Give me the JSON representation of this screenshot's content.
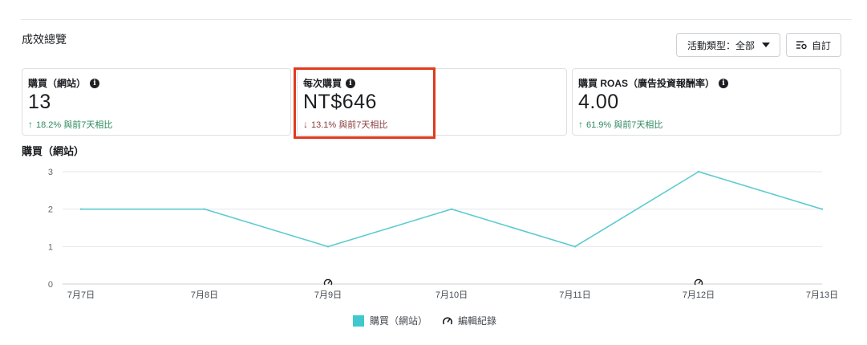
{
  "section": {
    "title": "成效總覽"
  },
  "toolbar": {
    "campaign_filter": "活動類型：全部",
    "custom_label": "自訂"
  },
  "metrics": [
    {
      "label": "購買（網站）",
      "value": "13",
      "change": "18.2% 與前7天相比",
      "direction": "up"
    },
    {
      "label": "每次購買",
      "value": "NT$646",
      "change": "13.1% 與前7天相比",
      "direction": "down"
    },
    {
      "label": "購買 ROAS（廣告投資報酬率）",
      "value": "4.00",
      "change": "61.9% 與前7天相比",
      "direction": "up"
    }
  ],
  "chart_title": "購買（網站）",
  "chart_data": {
    "type": "line",
    "x": [
      "7月7日",
      "7月8日",
      "7月9日",
      "7月10日",
      "7月11日",
      "7月12日",
      "7月13日"
    ],
    "series": [
      {
        "name": "購買（網站）",
        "values": [
          2,
          2,
          1,
          2,
          1,
          3,
          2
        ],
        "color": "#5ccbd0"
      }
    ],
    "ylim": [
      0,
      3
    ],
    "yticks": [
      "0",
      "1",
      "2",
      "3"
    ],
    "grid": true,
    "edit_markers_at": [
      "7月9日",
      "7月12日"
    ],
    "legend_placement": "bottom-center"
  },
  "legend": {
    "series_label": "購買（網站）",
    "edit_log_label": "編輯紀錄"
  },
  "colors": {
    "accent": "#3fc8ce",
    "up": "#2e8a5f",
    "down": "#8a3c3c",
    "highlight": "#e03a1e"
  }
}
